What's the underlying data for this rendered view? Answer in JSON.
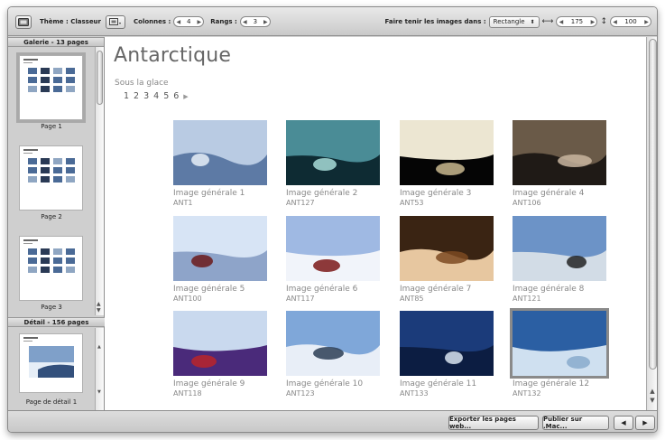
{
  "toolbar": {
    "theme_label": "Thème : Classeur",
    "columns_label": "Colonnes :",
    "columns_value": "4",
    "rows_label": "Rangs :",
    "rows_value": "3",
    "fit_label": "Faire tenir les images dans :",
    "fit_option": "Rectangle",
    "width_value": "175",
    "height_value": "100"
  },
  "sidebar": {
    "gallery_header": "Galerie - 13 pages",
    "gallery_pages": [
      "Page 1",
      "Page 2",
      "Page 3"
    ],
    "detail_header": "Détail - 156 pages",
    "detail_pages": [
      "Page de détail 1"
    ]
  },
  "main": {
    "title": "Antarctique",
    "subtitle": "Sous la glace",
    "pagination": [
      "1",
      "2",
      "3",
      "4",
      "5",
      "6"
    ],
    "items": [
      {
        "caption": "Image générale  1",
        "id": "ANT1",
        "colors": [
          "#b9cbe3",
          "#5d7aa5",
          "#e6eef7"
        ]
      },
      {
        "caption": "Image générale  2",
        "id": "ANT127",
        "colors": [
          "#4a8c96",
          "#0e2b33",
          "#a7dcd8"
        ]
      },
      {
        "caption": "Image générale  3",
        "id": "ANT53",
        "colors": [
          "#ece6d2",
          "#050505",
          "#c9b98f"
        ]
      },
      {
        "caption": "Image générale  4",
        "id": "ANT106",
        "colors": [
          "#6a5a48",
          "#1f1a16",
          "#c9b6a0"
        ]
      },
      {
        "caption": "Image générale  5",
        "id": "ANT100",
        "colors": [
          "#d7e4f5",
          "#8ea4c9",
          "#6b1a1a"
        ]
      },
      {
        "caption": "Image générale  6",
        "id": "ANT117",
        "colors": [
          "#9fb9e3",
          "#f1f4fa",
          "#7b1717"
        ]
      },
      {
        "caption": "Image générale  7",
        "id": "ANT85",
        "colors": [
          "#3a2413",
          "#e7c7a0",
          "#7d4a22"
        ]
      },
      {
        "caption": "Image générale  8",
        "id": "ANT121",
        "colors": [
          "#6c93c7",
          "#d2dce6",
          "#232323"
        ]
      },
      {
        "caption": "Image générale  9",
        "id": "ANT118",
        "colors": [
          "#c9d9ee",
          "#4a2a7a",
          "#b8242a"
        ]
      },
      {
        "caption": "Image générale  10",
        "id": "ANT123",
        "colors": [
          "#7fa7d9",
          "#e8eef7",
          "#2c3d55"
        ]
      },
      {
        "caption": "Image générale  11",
        "id": "ANT133",
        "colors": [
          "#1b3b7a",
          "#0c1d42",
          "#d9e4f0"
        ]
      },
      {
        "caption": "Image générale  12",
        "id": "ANT132",
        "colors": [
          "#2b5fa3",
          "#cfe0f0",
          "#88aacd"
        ]
      }
    ]
  },
  "bottom": {
    "export_label": "Exporter les pages web...",
    "publish_label": "Publier sur .Mac...",
    "prev_label": "◀",
    "next_label": "▶"
  }
}
